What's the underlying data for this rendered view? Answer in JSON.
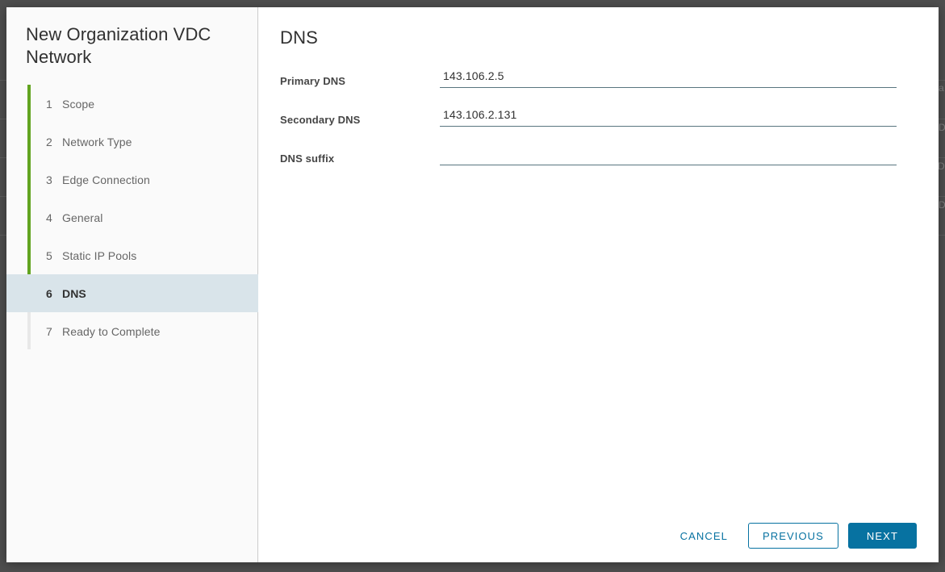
{
  "backdrop": {
    "glyphs": [
      "a",
      "D",
      "D",
      "D"
    ]
  },
  "wizard": {
    "title": "New Organization VDC Network",
    "steps": [
      {
        "num": "1",
        "label": "Scope",
        "active": false
      },
      {
        "num": "2",
        "label": "Network Type",
        "active": false
      },
      {
        "num": "3",
        "label": "Edge Connection",
        "active": false
      },
      {
        "num": "4",
        "label": "General",
        "active": false
      },
      {
        "num": "5",
        "label": "Static IP Pools",
        "active": false
      },
      {
        "num": "6",
        "label": "DNS",
        "active": true
      },
      {
        "num": "7",
        "label": "Ready to Complete",
        "active": false
      }
    ]
  },
  "content": {
    "title": "DNS",
    "fields": [
      {
        "label": "Primary DNS",
        "value": "143.106.2.5",
        "placeholder": ""
      },
      {
        "label": "Secondary DNS",
        "value": "143.106.2.131",
        "placeholder": ""
      },
      {
        "label": "DNS suffix",
        "value": "",
        "placeholder": ""
      }
    ]
  },
  "footer": {
    "cancel_label": "CANCEL",
    "previous_label": "PREVIOUS",
    "next_label": "NEXT"
  },
  "colors": {
    "primary_blue": "#0772A1",
    "progress_green": "#62A420",
    "active_step_bg": "#D9E4EA",
    "backdrop": "#4E4E4E"
  }
}
